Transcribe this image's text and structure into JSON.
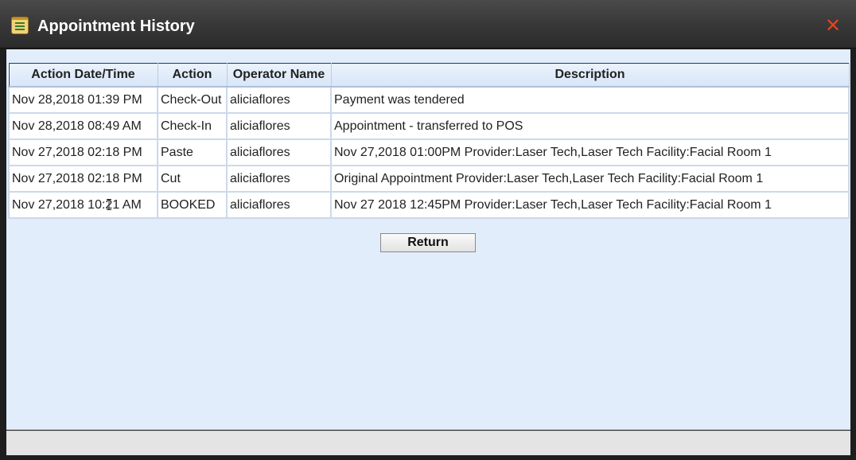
{
  "window": {
    "title": "Appointment History",
    "close_glyph": "✕",
    "icon": "notepad-icon"
  },
  "table": {
    "columns": [
      "Action Date/Time",
      "Action",
      "Operator Name",
      "Description"
    ],
    "rows": [
      [
        "Nov 28,2018 01:39 PM",
        "Check-Out",
        "aliciaflores",
        "Payment was tendered"
      ],
      [
        "Nov 28,2018 08:49 AM",
        "Check-In",
        "aliciaflores",
        "Appointment - transferred to POS"
      ],
      [
        "Nov 27,2018 02:18 PM",
        "Paste",
        "aliciaflores",
        "Nov 27,2018 01:00PM Provider:Laser Tech,Laser Tech Facility:Facial Room 1"
      ],
      [
        "Nov 27,2018 02:18 PM",
        "Cut",
        "aliciaflores",
        "Original Appointment Provider:Laser Tech,Laser Tech Facility:Facial Room 1"
      ],
      [
        "Nov 27,2018 10:21 AM",
        "BOOKED",
        "aliciaflores",
        "Nov 27 2018 12:45PM Provider:Laser Tech,Laser Tech Facility:Facial Room 1"
      ]
    ]
  },
  "buttons": {
    "return_label": "Return"
  },
  "colors": {
    "titlebar": "#3a3a3a",
    "body_background": "#e1edfb",
    "table_border": "#1d3f75",
    "close_icon": "#e8421c"
  }
}
